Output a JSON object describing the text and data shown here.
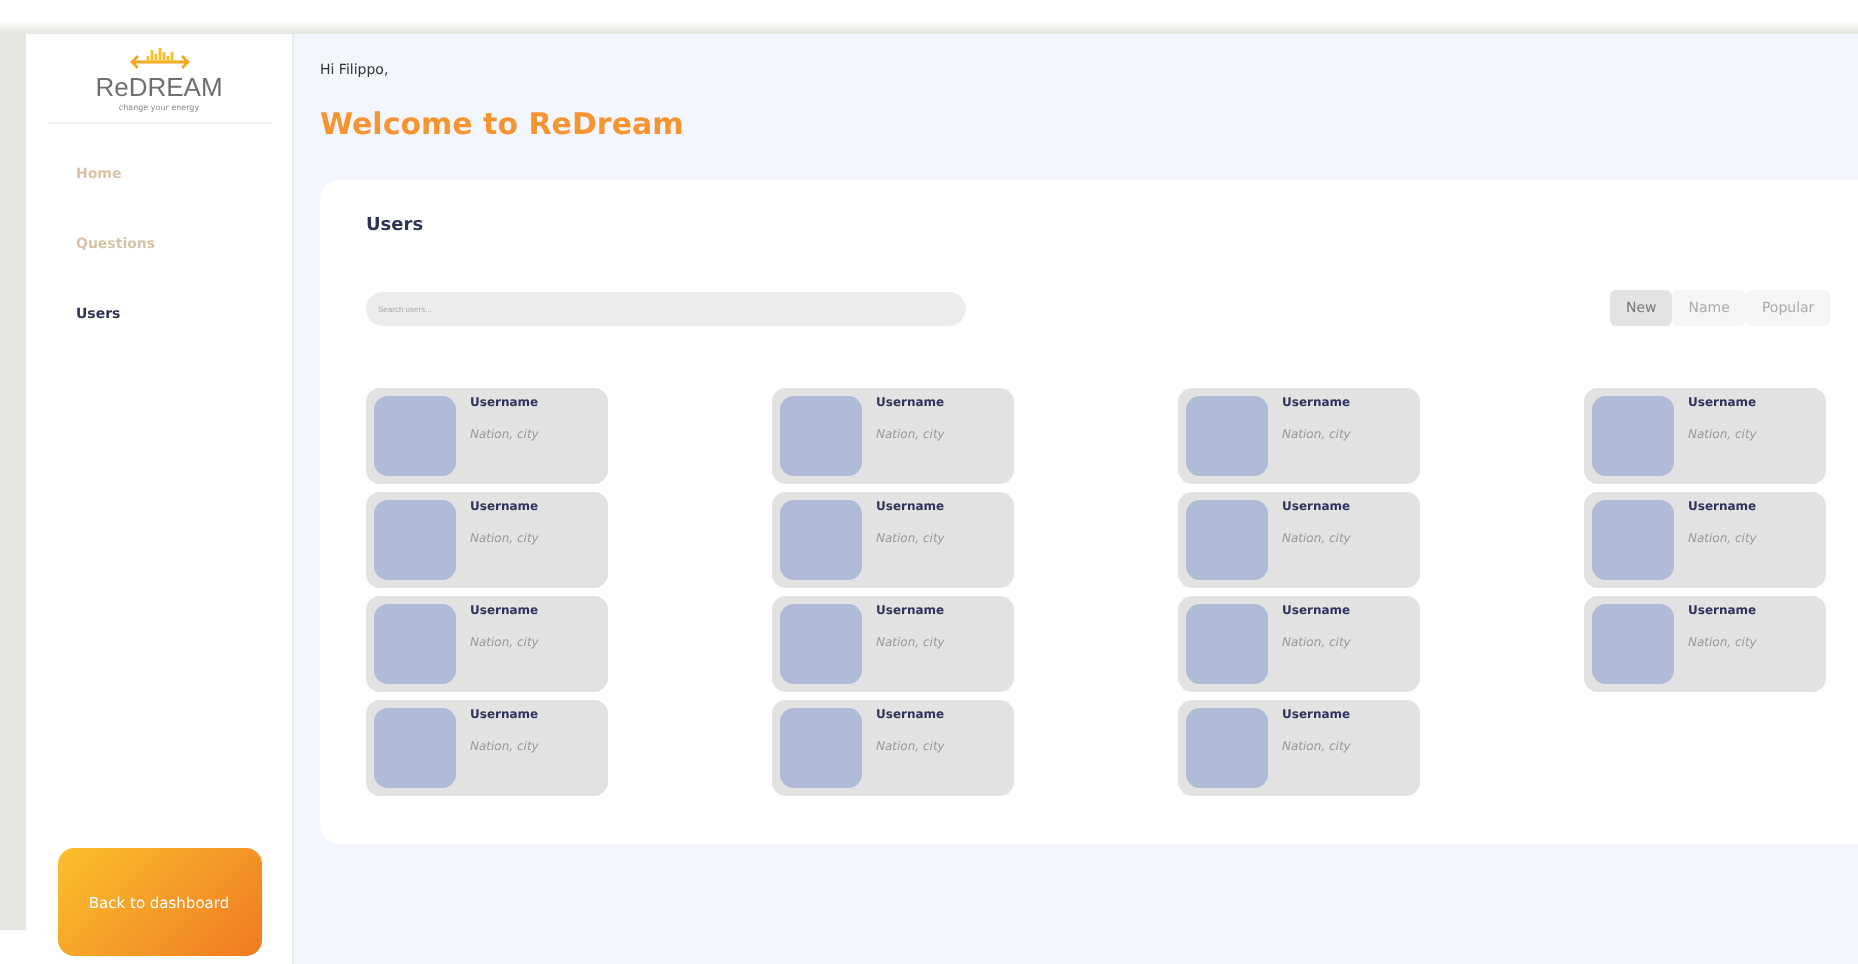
{
  "sidebar": {
    "logo": {
      "name": "ReDREAM",
      "tagline": "change your energy"
    },
    "items": [
      {
        "label": "Home",
        "selected": false
      },
      {
        "label": "Questions",
        "selected": false
      },
      {
        "label": "Users",
        "selected": true
      }
    ],
    "back_button": "Back to dashboard"
  },
  "header": {
    "greeting": "Hi Filippo,",
    "title": "Welcome to ReDream"
  },
  "users_panel": {
    "title": "Users",
    "search": {
      "placeholder": "Search users..."
    },
    "sort": [
      {
        "label": "New",
        "selected": true
      },
      {
        "label": "Name",
        "selected": false
      },
      {
        "label": "Popular",
        "selected": false
      }
    ],
    "users": [
      {
        "name": "Username",
        "location": "Nation, city"
      },
      {
        "name": "Username",
        "location": "Nation, city"
      },
      {
        "name": "Username",
        "location": "Nation, city"
      },
      {
        "name": "Username",
        "location": "Nation, city"
      },
      {
        "name": "Username",
        "location": "Nation, city"
      },
      {
        "name": "Username",
        "location": "Nation, city"
      },
      {
        "name": "Username",
        "location": "Nation, city"
      },
      {
        "name": "Username",
        "location": "Nation, city"
      },
      {
        "name": "Username",
        "location": "Nation, city"
      },
      {
        "name": "Username",
        "location": "Nation, city"
      },
      {
        "name": "Username",
        "location": "Nation, city"
      },
      {
        "name": "Username",
        "location": "Nation, city"
      },
      {
        "name": "Username",
        "location": "Nation, city"
      },
      {
        "name": "Username",
        "location": "Nation, city"
      },
      {
        "name": "Username",
        "location": "Nation, city"
      }
    ]
  }
}
